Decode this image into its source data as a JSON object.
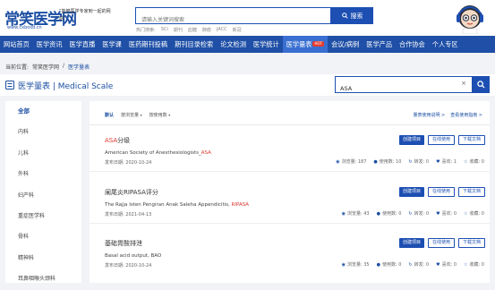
{
  "header": {
    "logo": "常笑医学网",
    "logo_url": "www.cxbosd.cn",
    "slogan": "“能够医学专家到一起的网站”",
    "search_placeholder": "请输入关键词搜索",
    "search_button": "搜索",
    "hotwords_label": "热门搜索:",
    "hotwords": [
      "SCI",
      "期刊",
      "血糖",
      "肺癌",
      "JACC",
      "新冠"
    ]
  },
  "nav": {
    "items": [
      {
        "label": "网站首页"
      },
      {
        "label": "医学资讯"
      },
      {
        "label": "医学直播"
      },
      {
        "label": "医学课"
      },
      {
        "label": "医药期刊投稿"
      },
      {
        "label": "期刊目录检索"
      },
      {
        "label": "论文检测"
      },
      {
        "label": "医学统计"
      },
      {
        "label": "医学量表",
        "badge": "HOT"
      },
      {
        "label": "会议/病例"
      },
      {
        "label": "医学产品"
      },
      {
        "label": "合作协会"
      },
      {
        "label": "个人专区"
      }
    ]
  },
  "breadcrumb": [
    "当前位置:",
    "常笑医学网",
    "/",
    "医学量表"
  ],
  "title_bar": {
    "title": "医学量表 | Medical Scale",
    "search_value": "ASA",
    "clear": "×"
  },
  "sidebar": {
    "items": [
      "全部",
      "内科",
      "儿科",
      "外科",
      "妇产科",
      "重症医学科",
      "骨科",
      "精神科",
      "耳鼻咽喉头颈科"
    ]
  },
  "filters": {
    "default": "默认",
    "by_views": "按浏览量",
    "by_usage": "按使用数",
    "links": [
      "量表使用说明 >",
      "查看使用指南 >"
    ]
  },
  "items": [
    {
      "title_hl": "ASA",
      "title_rest": "分级",
      "sub_pre": "American Society of Anesthesiologists_",
      "sub_hl": "ASA",
      "date": "发布日期: 2020-10-24",
      "btn1": "创建项目",
      "btn2": "在线使用",
      "btn3": "下载文档",
      "views": "浏览量: 187",
      "uses": "使用数: 10",
      "shares": "转发: 0",
      "likes": "喜欢: 1",
      "favs": "收藏: 0"
    },
    {
      "title_hl": "",
      "title_rest": "阑尾炎RIPASA评分",
      "sub_pre": "The Rajja Isten Pengiran Anak Saleha Appendicitis, ",
      "sub_hl": "RIPASA",
      "date": "发布日期: 2021-04-13",
      "btn1": "创建项目",
      "btn2": "在线使用",
      "btn3": "下载文档",
      "views": "浏览量: 43",
      "uses": "使用数: 0",
      "shares": "转发: 0",
      "likes": "喜欢: 0",
      "favs": "收藏: 0"
    },
    {
      "title_hl": "",
      "title_rest": "基础胃酸排泄",
      "sub_pre": "Basal acid output, BAO",
      "sub_hl": "",
      "date": "发布日期: 2020-10-24",
      "btn1": "创建项目",
      "btn2": "在线使用",
      "btn3": "下载文档",
      "views": "浏览量: 35",
      "uses": "使用数: 0",
      "shares": "转发: 0",
      "likes": "喜欢: 0",
      "favs": "收藏: 0"
    }
  ]
}
